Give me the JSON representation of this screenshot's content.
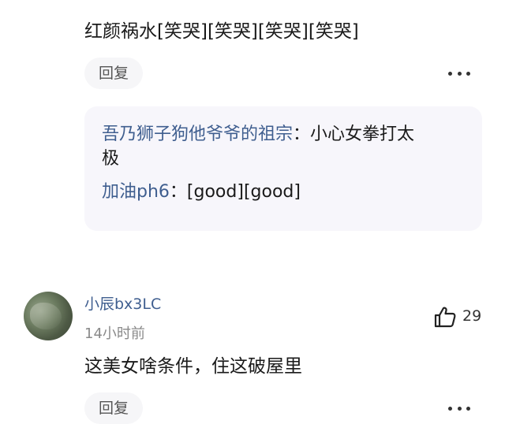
{
  "comment1": {
    "text": "红颜祸水[笑哭][笑哭][笑哭][笑哭]",
    "reply_label": "回复",
    "replies": [
      {
        "author": "吾乃狮子狗他爷爷的祖宗",
        "separator": "：",
        "line1": "小心女拳打太",
        "line2": "极"
      },
      {
        "author": "加油ph6",
        "separator": "：",
        "text": "[good][good]"
      }
    ]
  },
  "comment2": {
    "username": "小辰bx3LC",
    "timestamp": "14小时前",
    "text": "这美女啥条件，住这破屋里",
    "like_count": "29",
    "reply_label": "回复"
  },
  "icons": {
    "more": "more-horizontal-icon",
    "like": "thumbs-up-icon",
    "avatar": "user-avatar"
  }
}
